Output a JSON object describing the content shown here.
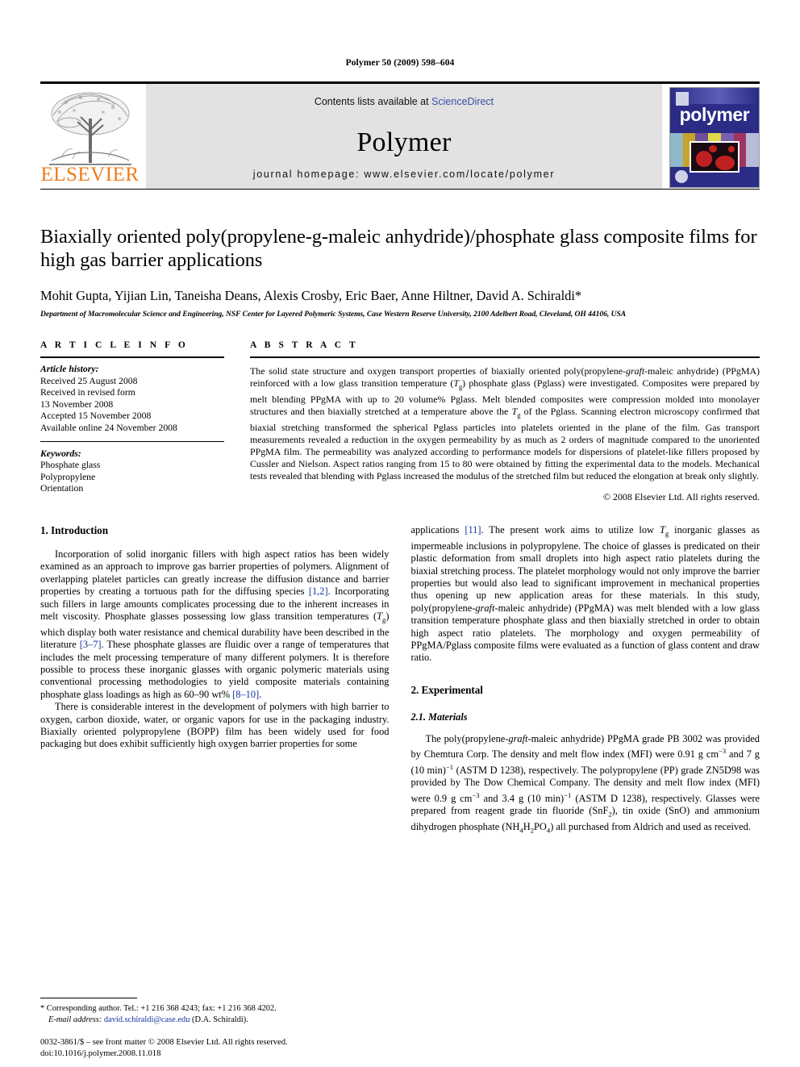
{
  "running_head": "Polymer 50 (2009) 598–604",
  "masthead": {
    "elsevier_wordmark": "ELSEVIER",
    "contents_prefix": "Contents lists available at ",
    "sciencedirect": "ScienceDirect",
    "journal_title": "Polymer",
    "homepage": "journal homepage: www.elsevier.com/locate/polymer",
    "cover_word": "polymer",
    "cover_footer": "",
    "accent_blue": "#3a4ea8",
    "elsevier_orange": "#f07c1b",
    "banner_gray": "#e2e2e2",
    "cover_blue": "#2a2c86"
  },
  "article": {
    "title": "Biaxially oriented poly(propylene-g-maleic anhydride)/phosphate glass composite films for high gas barrier applications",
    "authors": "Mohit Gupta, Yijian Lin, Taneisha Deans, Alexis Crosby, Eric Baer, Anne Hiltner, David A. Schiraldi*",
    "affiliation": "Department of Macromolecular Science and Engineering, NSF Center for Layered Polymeric Systems, Case Western Reserve University, 2100 Adelbert Road, Cleveland, OH 44106, USA"
  },
  "info": {
    "heading": "A R T I C L E   I N F O",
    "history_label": "Article history:",
    "history": [
      "Received 25 August 2008",
      "Received in revised form",
      "13 November 2008",
      "Accepted 15 November 2008",
      "Available online 24 November 2008"
    ],
    "keywords_label": "Keywords:",
    "keywords": [
      "Phosphate glass",
      "Polypropylene",
      "Orientation"
    ]
  },
  "abstract": {
    "heading": "A B S T R A C T",
    "text_1": "The solid state structure and oxygen transport properties of biaxially oriented poly(propylene-",
    "graft_italic": "graft",
    "text_2": "-maleic anhydride) (PPgMA) reinforced with a low glass transition temperature (",
    "tg_italic": "T",
    "tg_sub": "g",
    "text_3": ") phosphate glass (Pglass) were investigated. Composites were prepared by melt blending PPgMA with up to 20 volume% Pglass. Melt blended composites were compression molded into monolayer structures and then biaxially stretched at a temperature above the ",
    "text_4": " of the Pglass. Scanning electron microscopy confirmed that biaxial stretching transformed the spherical Pglass particles into platelets oriented in the plane of the film. Gas transport measurements revealed a reduction in the oxygen permeability by as much as 2 orders of magnitude compared to the unoriented PPgMA film. The permeability was analyzed according to performance models for dispersions of platelet-like fillers proposed by Cussler and Nielson. Aspect ratios ranging from 15 to 80 were obtained by fitting the experimental data to the models. Mechanical tests revealed that blending with Pglass increased the modulus of the stretched film but reduced the elongation at break only slightly.",
    "copyright": "© 2008 Elsevier Ltd. All rights reserved."
  },
  "sections": {
    "introduction_heading": "1. Introduction",
    "experimental_heading": "2. Experimental",
    "materials_heading": "2.1. Materials"
  },
  "body": {
    "intro_p1_a": "Incorporation of solid inorganic fillers with high aspect ratios has been widely examined as an approach to improve gas barrier properties of polymers. Alignment of overlapping platelet particles can greatly increase the diffusion distance and barrier properties by creating a tortuous path for the diffusing species ",
    "intro_p1_ref1": "[1,2]",
    "intro_p1_b": ". Incorporating such fillers in large amounts complicates processing due to the inherent increases in melt viscosity. Phosphate glasses possessing low glass transition temperatures (",
    "intro_p1_c": ") which display both water resistance and chemical durability have been described in the literature ",
    "intro_p1_ref2": "[3–7]",
    "intro_p1_d": ". These phosphate glasses are fluidic over a range of temperatures that includes the melt processing temperature of many different polymers. It is therefore possible to process these inorganic glasses with organic polymeric materials using conventional processing methodologies to yield composite materials containing phosphate glass loadings as high as 60–90 wt% ",
    "intro_p1_ref3": "[8–10]",
    "intro_p1_e": ".",
    "intro_p2": "There is considerable interest in the development of polymers with high barrier to oxygen, carbon dioxide, water, or organic vapors for use in the packaging industry. Biaxially oriented polypropylene (BOPP) film has been widely used for food packaging but does exhibit sufficiently high oxygen barrier properties for some",
    "intro_p3_a": "applications ",
    "intro_p3_ref": "[11]",
    "intro_p3_b": ". The present work aims to utilize low ",
    "intro_p3_c": " inorganic glasses as impermeable inclusions in polypropylene. The choice of glasses is predicated on their plastic deformation from small droplets into high aspect ratio platelets during the biaxial stretching process. The platelet morphology would not only improve the barrier properties but would also lead to significant improvement in mechanical properties thus opening up new application areas for these materials. In this study, poly(propylene-",
    "intro_p3_d": "-maleic anhydride) (PPgMA) was melt blended with a low glass transition temperature phosphate glass and then biaxially stretched in order to obtain high aspect ratio platelets. The morphology and oxygen permeability of PPgMA/Pglass composite films were evaluated as a function of glass content and draw ratio.",
    "materials_a": "The poly(propylene-",
    "materials_b": "-maleic anhydride) PPgMA grade PB 3002 was provided by Chemtura Corp. The density and melt flow index (MFI) were 0.91 g cm",
    "materials_c": " and 7 g (10 min)",
    "materials_d": " (ASTM D 1238), respectively. The polypropylene (PP) grade ZN5D98 was provided by The Dow Chemical Company. The density and melt flow index (MFI) were 0.9 g cm",
    "materials_e": " and 3.4 g (10 min)",
    "materials_f": " (ASTM D 1238), respectively. Glasses were prepared from reagent grade tin fluoride (SnF",
    "materials_g": "), tin oxide (SnO) and ammonium dihydrogen phosphate (NH",
    "materials_h": "PO",
    "materials_i": ") all purchased from Aldrich and used as received."
  },
  "footnote": {
    "corresponding": "* Corresponding author. Tel.: +1 216 368 4243; fax: +1 216 368 4202.",
    "email_label": "E-mail address:",
    "email": "david.schiraldi@case.edu",
    "email_suffix": " (D.A. Schiraldi)."
  },
  "imprint": {
    "line1": "0032-3861/$ – see front matter © 2008 Elsevier Ltd. All rights reserved.",
    "line2": "doi:10.1016/j.polymer.2008.11.018"
  }
}
